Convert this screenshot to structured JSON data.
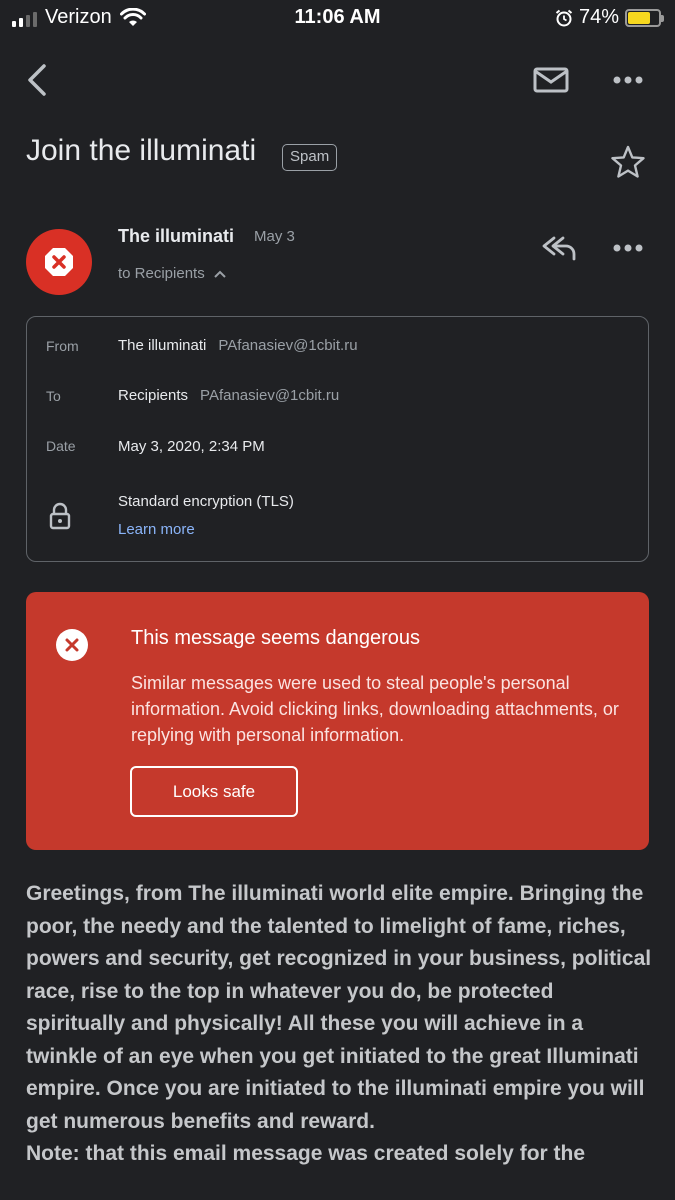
{
  "status_bar": {
    "carrier": "Verizon",
    "time": "11:06 AM",
    "battery_pct": "74%",
    "battery_level": 0.74,
    "signal_bars": 2,
    "icons": [
      "signal-icon",
      "wifi-icon",
      "alarm-icon",
      "battery-icon"
    ]
  },
  "app_bar": {
    "icons": [
      "back-arrow-icon",
      "mail-icon",
      "more-horizontal-icon"
    ]
  },
  "email": {
    "subject": "Join the illuminati",
    "label": "Spam",
    "sender_name": "The illuminati",
    "sender_date": "May 3",
    "to_line": "to Recipients"
  },
  "details": {
    "from_label": "From",
    "from_name": "The illuminati",
    "from_email": "PAfanasiev@1cbit.ru",
    "to_label": "To",
    "to_name": "Recipients",
    "to_email": "PAfanasiev@1cbit.ru",
    "date_label": "Date",
    "date_value": "May 3, 2020, 2:34 PM",
    "encryption": "Standard encryption (TLS)",
    "learn_more": "Learn more"
  },
  "warning": {
    "title": "This message seems dangerous",
    "body": "Similar messages were used to steal people's personal information. Avoid clicking links, downloading attachments, or replying with personal information.",
    "button": "Looks safe",
    "color": "#c5392c"
  },
  "body": {
    "paragraph_1": "Greetings, from The illuminati world elite empire. Bringing the poor, the needy and the talented to limelight of fame, riches, powers and security, get recognized in your business, political race, rise to the top in whatever you do, be protected spiritually and physically! All these you will achieve in a twinkle of an eye when you get initiated to the great Illuminati empire. Once you are initiated to the illuminati empire you will get numerous benefits and reward.",
    "paragraph_2": "Note: that this email message was created solely for the"
  },
  "colors": {
    "background": "#202124",
    "danger": "#d93025",
    "link": "#8ab4f8"
  }
}
